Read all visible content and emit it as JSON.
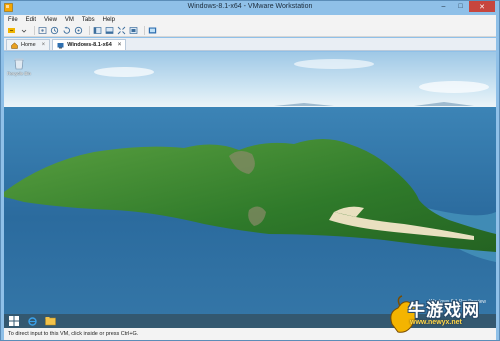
{
  "window": {
    "title": "Windows-8.1-x64 - VMware Workstation"
  },
  "menu": [
    "File",
    "Edit",
    "View",
    "VM",
    "Tabs",
    "Help"
  ],
  "tabs": [
    {
      "label": "Home",
      "active": false
    },
    {
      "label": "Windows-8.1-x64",
      "active": true
    }
  ],
  "desktop": {
    "recycle_bin_label": "Recycle Bin",
    "os_watermark": "Windows 8.1 Pro Preview"
  },
  "status": {
    "text": "To direct input to this VM, click inside or press Ctrl+G."
  },
  "overlay": {
    "site_name": "牛游戏网",
    "site_url": "www.newyx.net"
  },
  "colors": {
    "titlebar": "#8fc0e8",
    "close_button": "#c7463e",
    "ocean": "#2c6c9f",
    "island": "#3c8a2f"
  }
}
